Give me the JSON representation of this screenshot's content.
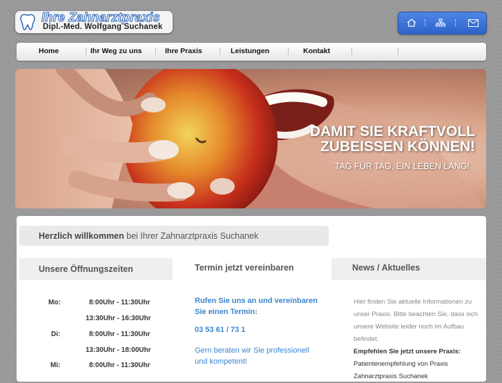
{
  "logo": {
    "title": "Ihre Zahnarztpraxis",
    "subtitle": "Dipl.-Med. Wolfgang Suchanek"
  },
  "toolbar": {
    "icons": [
      "home-icon",
      "sitemap-icon",
      "mail-icon"
    ]
  },
  "nav": {
    "items": [
      "Home",
      "Ihr Weg zu uns",
      "Ihre Praxis",
      "Leistungen",
      "Kontakt"
    ]
  },
  "hero": {
    "line1": "DAMIT SIE KRAFTVOLL",
    "line2": "ZUBEISSEN KÖNNEN!",
    "line3": "TAG FÜR TAG, EIN LEBEN LANG!"
  },
  "welcome": {
    "bold": "Herzlich willkommen",
    "rest": " bei Ihrer Zahnarztpraxis Suchanek"
  },
  "hours": {
    "heading": "Unsere Öffnungszeiten",
    "rows": [
      {
        "day": "Mo:",
        "time": "8:00Uhr - 11:30Uhr"
      },
      {
        "day": "",
        "time": "13:30Uhr - 16:30Uhr"
      },
      {
        "day": "Di:",
        "time": "8:00Uhr - 11:30Uhr"
      },
      {
        "day": "",
        "time": "13:30Uhr - 18:00Uhr"
      },
      {
        "day": "Mi:",
        "time": "8:00Uhr - 11:30Uhr"
      }
    ]
  },
  "termin": {
    "heading": "Termin jetzt vereinbaren",
    "call": "Rufen Sie uns an und vereinbaren Sie einen Termin:",
    "phone": "03 53 61 / 73 1",
    "advice": "Gern beraten wir Sie professionell und kompetent!"
  },
  "news": {
    "heading": "News / Aktuelles",
    "intro": "Hier finden Sie aktuelle Informationen zu unser Praxis. Bitte beachten Sie, dass sich unsere Website leider noch im Aufbau befindet.",
    "recommend": "Empfehlen Sie jetzt unsere Praxis:",
    "link": "Patientenempfehlung von Praxis",
    "link2": "Zahnarztpraxis Suchanek"
  }
}
